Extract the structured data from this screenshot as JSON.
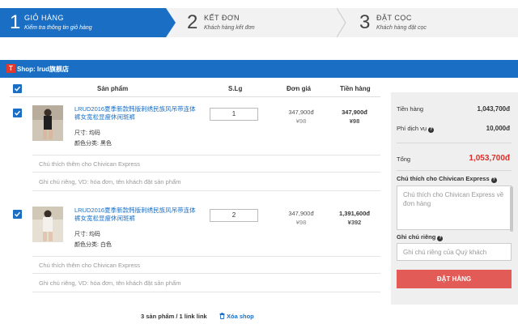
{
  "steps": [
    {
      "num": "1",
      "title": "GIỎ HÀNG",
      "subtitle": "Kiểm tra thông tin giỏ hàng"
    },
    {
      "num": "2",
      "title": "KẾT ĐƠN",
      "subtitle": "Khách hàng kết đơn"
    },
    {
      "num": "3",
      "title": "ĐẶT CỌC",
      "subtitle": "Khách hàng đặt cọc"
    }
  ],
  "shop": {
    "logo": "T",
    "name": "Shop: lrud旗舰店"
  },
  "table": {
    "headers": {
      "product": "Sản phẩm",
      "qty": "S.Lg",
      "unit_price": "Đơn giá",
      "total": "Tiền hàng"
    }
  },
  "items": [
    {
      "name": "LRUD2016夏季新款韩版刺绣民族风吊带连体裤女宽松显瘦休闲斑裤",
      "size": "尺寸: 均码",
      "color": "颜色分类: 黑色",
      "qty": "1",
      "unit_vnd": "347,900đ",
      "unit_cny": "¥98",
      "total_vnd": "347,900đ",
      "total_cny": "¥98",
      "note1_placeholder": "Chú thích thêm cho Chivican Express",
      "note2_placeholder": "Ghi chú riêng, VD: hóa đơn, tên khách đặt sản phẩm"
    },
    {
      "name": "LRUD2016夏季新款韩版刺绣民族风吊带连体裤女宽松显瘦休闲斑裤",
      "size": "尺寸: 均码",
      "color": "颜色分类: 白色",
      "qty": "2",
      "unit_vnd": "347,900đ",
      "unit_cny": "¥98",
      "total_vnd": "1,391,600đ",
      "total_cny": "¥392",
      "note1_placeholder": "Chú thích thêm cho Chivican Express",
      "note2_placeholder": "Ghi chú riêng, VD: hóa đơn, tên khách đặt sản phẩm"
    }
  ],
  "footer": {
    "summary": "3 sản phẩm / 1 link link",
    "delete_shop": "Xóa shop"
  },
  "summary": {
    "goods_label": "Tiền hàng",
    "goods_value": "1,043,700đ",
    "service_label": "Phí dịch vụ",
    "service_value": "10,000đ",
    "total_label": "Tổng",
    "total_value": "1,053,700đ",
    "note_label": "Chú thích cho Chivican Express",
    "note_placeholder": "Chú thích cho Chivican Express về đơn hàng",
    "private_label": "Ghi chú riêng",
    "private_placeholder": "Ghi chú riêng của Quý khách",
    "order_button": "ĐẶT HÀNG"
  },
  "colors": {
    "primary": "#1a6fc4",
    "total_red": "#d9302c",
    "order_button": "#e35b57",
    "logo_red": "#e03a2e"
  }
}
